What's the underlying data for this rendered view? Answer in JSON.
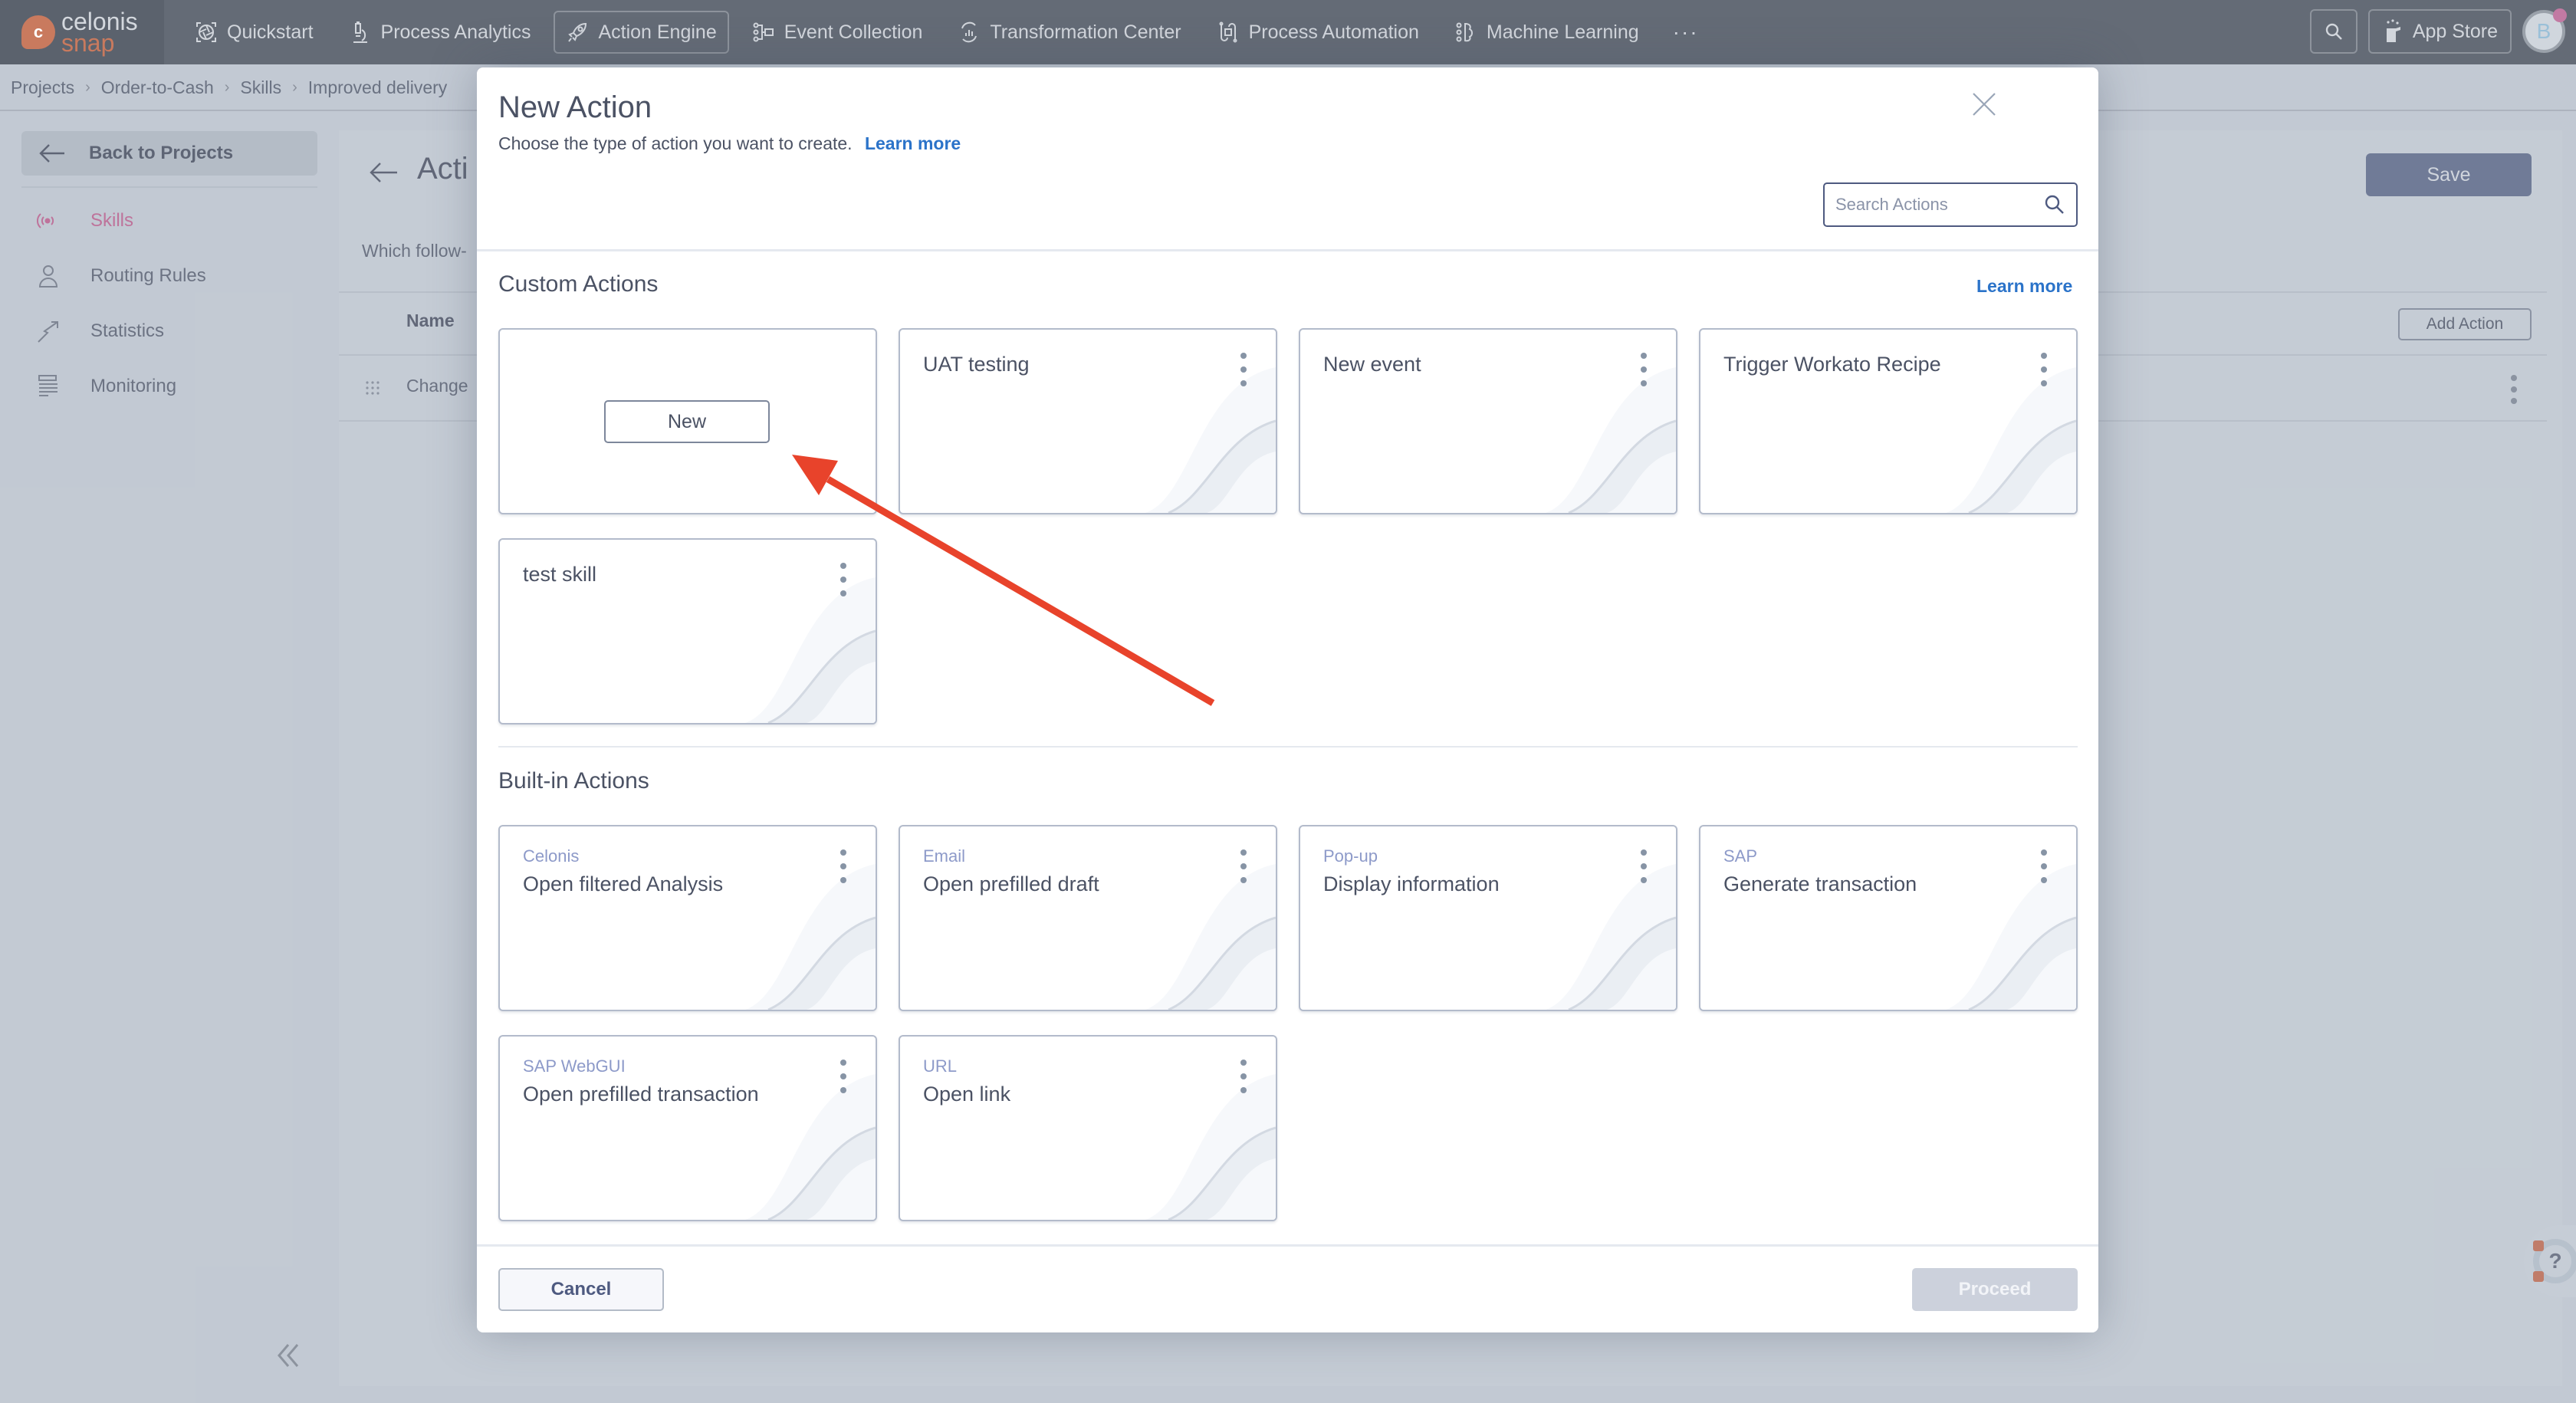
{
  "topbar": {
    "logo": {
      "line1": "celonis",
      "line2": "snap",
      "mark": "c"
    },
    "nav": [
      {
        "label": "Quickstart",
        "icon": "quickstart-aperture-icon",
        "active": false
      },
      {
        "label": "Process Analytics",
        "icon": "microscope-icon",
        "active": false
      },
      {
        "label": "Action Engine",
        "icon": "rocket-icon",
        "active": true
      },
      {
        "label": "Event Collection",
        "icon": "event-collection-icon",
        "active": false
      },
      {
        "label": "Transformation Center",
        "icon": "transformation-icon",
        "active": false
      },
      {
        "label": "Process Automation",
        "icon": "automation-icon",
        "active": false
      },
      {
        "label": "Machine Learning",
        "icon": "brain-icon",
        "active": false
      }
    ],
    "more": "···",
    "app_store_label": "App Store",
    "avatar_initial": "B"
  },
  "breadcrumb": [
    "Projects",
    "Order-to-Cash",
    "Skills",
    "Improved delivery"
  ],
  "sidebar": {
    "back_label": "Back to Projects",
    "items": [
      {
        "label": "Skills",
        "icon": "skills-signal-icon",
        "active": true
      },
      {
        "label": "Routing Rules",
        "icon": "user-icon",
        "active": false
      },
      {
        "label": "Statistics",
        "icon": "trend-arrow-icon",
        "active": false
      },
      {
        "label": "Monitoring",
        "icon": "list-lines-icon",
        "active": false
      }
    ]
  },
  "background_page": {
    "title": "Acti",
    "subtitle": "Which follow-",
    "table_header_name": "Name",
    "row_name": "Change",
    "save_label": "Save",
    "add_action_label": "Add Action"
  },
  "modal": {
    "title": "New Action",
    "subtitle": "Choose the type of action you want to create.",
    "learn_more": "Learn more",
    "search_placeholder": "Search Actions",
    "search_value": "",
    "custom_section": {
      "title": "Custom Actions",
      "learn_more": "Learn more",
      "new_button_label": "New",
      "cards": [
        {
          "title": "UAT testing"
        },
        {
          "title": "New event"
        },
        {
          "title": "Trigger Workato Recipe"
        },
        {
          "title": "test skill"
        }
      ]
    },
    "builtin_section": {
      "title": "Built-in Actions",
      "cards": [
        {
          "category": "Celonis",
          "title": "Open filtered Analysis"
        },
        {
          "category": "Email",
          "title": "Open prefilled draft"
        },
        {
          "category": "Pop-up",
          "title": "Display information"
        },
        {
          "category": "SAP",
          "title": "Generate transaction"
        },
        {
          "category": "SAP WebGUI",
          "title": "Open prefilled transaction"
        },
        {
          "category": "URL",
          "title": "Open link"
        }
      ]
    },
    "cancel_label": "Cancel",
    "proceed_label": "Proceed"
  },
  "colors": {
    "accent_link": "#2b73c9",
    "active_sidebar": "#c0719a",
    "annotation_arrow": "#e8432b",
    "topbar_bg": "#646b76"
  }
}
